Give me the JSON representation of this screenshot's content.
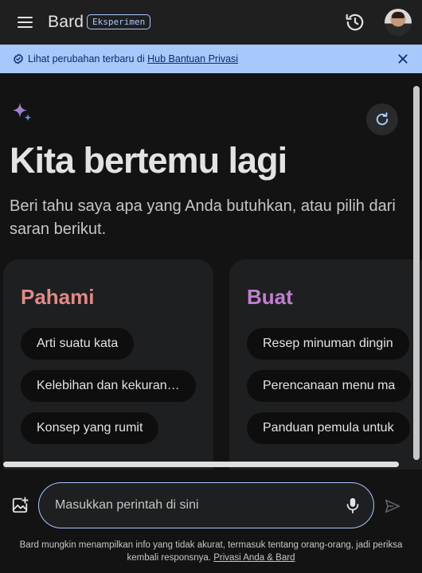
{
  "header": {
    "brand": "Bard",
    "badge": "Eksperimen"
  },
  "banner": {
    "text": "Lihat perubahan terbaru di ",
    "link": "Hub Bantuan Privasi"
  },
  "main": {
    "greeting": "Kita bertemu lagi",
    "subtitle": "Beri tahu saya apa yang Anda butuhkan, atau pilih dari saran berikut.",
    "cards": [
      {
        "title": "Pahami",
        "chips": [
          "Arti suatu kata",
          "Kelebihan dan kekuran…",
          "Konsep yang rumit"
        ]
      },
      {
        "title": "Buat",
        "chips": [
          "Resep minuman dingin",
          "Perencanaan menu ma",
          "Panduan pemula untuk"
        ]
      }
    ]
  },
  "prompt": {
    "placeholder": "Masukkan perintah di sini"
  },
  "footer": {
    "disclaimer": "Bard mungkin menampilkan info yang tidak akurat, termasuk tentang orang-orang, jadi periksa kembali responsnya. ",
    "link": "Privasi Anda & Bard"
  },
  "colors": {
    "accent": "#a8c7fa",
    "pahami": "#e08a86",
    "buat": "#c17fd0",
    "background": "#131314"
  },
  "icons": [
    "menu-icon",
    "history-icon",
    "check-circle-icon",
    "close-icon",
    "sparkle-icon",
    "refresh-icon",
    "add-image-icon",
    "mic-icon",
    "send-icon"
  ]
}
